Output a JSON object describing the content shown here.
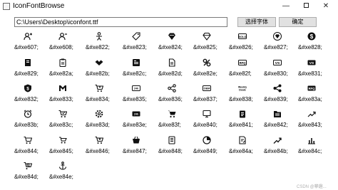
{
  "window": {
    "title": "IconFontBrowse"
  },
  "toolbar": {
    "path_value": "C:\\Users\\Desktop\\iconfont.ttf",
    "choose_font_label": "选择字体",
    "confirm_label": "确定"
  },
  "icons": [
    {
      "code": "&#xe607;",
      "icon": "user-plus-icon"
    },
    {
      "code": "&#xe608;",
      "icon": "user-minus-icon"
    },
    {
      "code": "&#xe822;",
      "icon": "person-icon"
    },
    {
      "code": "&#xe823;",
      "icon": "tag-icon"
    },
    {
      "code": "&#xe824;",
      "icon": "diamond-icon"
    },
    {
      "code": "&#xe825;",
      "icon": "diamond-outline-icon"
    },
    {
      "code": "&#xe826;",
      "icon": "sold-badge-icon"
    },
    {
      "code": "&#xe827;",
      "icon": "diamond-filled-icon"
    },
    {
      "code": "&#xe828;",
      "icon": "dollar-circle-icon"
    },
    {
      "code": "&#xe829;",
      "icon": "book-icon"
    },
    {
      "code": "&#xe82a;",
      "icon": "clipboard-icon"
    },
    {
      "code": "&#xe82b;",
      "icon": "handshake-icon"
    },
    {
      "code": "&#xe82c;",
      "icon": "news-icon"
    },
    {
      "code": "&#xe82d;",
      "icon": "document-icon"
    },
    {
      "code": "&#xe82e;",
      "icon": "percent-icon"
    },
    {
      "code": "&#xe82f;",
      "icon": "rfq-badge-icon"
    },
    {
      "code": "&#xe830;",
      "icon": "vs-badge-icon"
    },
    {
      "code": "&#xe831;",
      "icon": "vs-badge-filled-icon"
    },
    {
      "code": "&#xe832;",
      "icon": "shield-dollar-icon"
    },
    {
      "code": "&#xe833;",
      "icon": "gmail-icon"
    },
    {
      "code": "&#xe834;",
      "icon": "cart-add-icon"
    },
    {
      "code": "&#xe835;",
      "icon": "stat-badge-icon"
    },
    {
      "code": "&#xe836;",
      "icon": "share-icon"
    },
    {
      "code": "&#xe837;",
      "icon": "oem-badge-icon"
    },
    {
      "code": "&#xe838;",
      "icon": "weekly-deals-icon"
    },
    {
      "code": "&#xe839;",
      "icon": "share-filled-icon"
    },
    {
      "code": "&#xe83a;",
      "icon": "rfq-filled-icon"
    },
    {
      "code": "&#xe83b;",
      "icon": "alarm-icon"
    },
    {
      "code": "&#xe83c;",
      "icon": "cart-check-icon"
    },
    {
      "code": "&#xe83d;",
      "icon": "settings-cog-icon"
    },
    {
      "code": "&#xe83e;",
      "icon": "stat-filled-icon"
    },
    {
      "code": "&#xe83f;",
      "icon": "cart-icon"
    },
    {
      "code": "&#xe840;",
      "icon": "screen-icon"
    },
    {
      "code": "&#xe841;",
      "icon": "clipboard-list-icon"
    },
    {
      "code": "&#xe842;",
      "icon": "folder-list-icon"
    },
    {
      "code": "&#xe843;",
      "icon": "trend-up-icon"
    },
    {
      "code": "&#xe844;",
      "icon": "cart-outline-icon"
    },
    {
      "code": "&#xe845;",
      "icon": "cart-small-icon"
    },
    {
      "code": "&#xe846;",
      "icon": "cart-x-icon"
    },
    {
      "code": "&#xe847;",
      "icon": "basket-icon"
    },
    {
      "code": "&#xe848;",
      "icon": "doc-lines-icon"
    },
    {
      "code": "&#xe849;",
      "icon": "pie-chart-icon"
    },
    {
      "code": "&#xe84a;",
      "icon": "doc-edit-icon"
    },
    {
      "code": "&#xe84b;",
      "icon": "trend-up-line-icon"
    },
    {
      "code": "&#xe84c;",
      "icon": "bar-chart-icon"
    },
    {
      "code": "&#xe84d;",
      "icon": "cart-search-icon"
    },
    {
      "code": "&#xe84e;",
      "icon": "anchor-icon"
    }
  ],
  "watermark": "CSDN @攀趣..."
}
